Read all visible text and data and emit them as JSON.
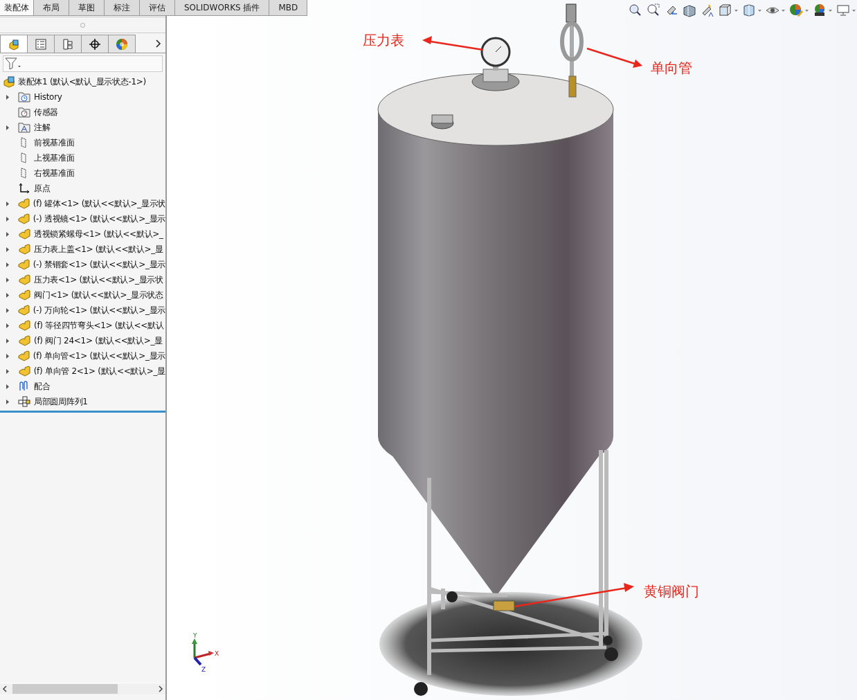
{
  "tabs": [
    {
      "label": "装配体",
      "selected": true
    },
    {
      "label": "布局",
      "selected": false
    },
    {
      "label": "草图",
      "selected": false
    },
    {
      "label": "标注",
      "selected": false
    },
    {
      "label": "评估",
      "selected": false
    },
    {
      "label": "SOLIDWORKS 插件",
      "selected": false
    },
    {
      "label": "MBD",
      "selected": false
    }
  ],
  "panel_tabs": [
    {
      "kind": "feature",
      "selected": true
    },
    {
      "kind": "property",
      "selected": false
    },
    {
      "kind": "config",
      "selected": false
    },
    {
      "kind": "dim",
      "selected": false
    },
    {
      "kind": "display",
      "selected": false
    }
  ],
  "tree": {
    "root": {
      "kind": "assembly",
      "label": "装配体1 (默认<默认_显示状态-1>)"
    },
    "items": [
      {
        "kind": "history",
        "label": "History",
        "expander": true
      },
      {
        "kind": "sensor",
        "label": "传感器",
        "expander": false
      },
      {
        "kind": "annotation",
        "label": "注解",
        "expander": true
      },
      {
        "kind": "plane",
        "label": "前视基准面",
        "expander": false
      },
      {
        "kind": "plane",
        "label": "上视基准面",
        "expander": false
      },
      {
        "kind": "plane",
        "label": "右视基准面",
        "expander": false
      },
      {
        "kind": "origin",
        "label": "原点",
        "expander": false
      },
      {
        "kind": "part",
        "label": "(f) 罐体<1> (默认<<默认>_显示状",
        "expander": true
      },
      {
        "kind": "part",
        "label": "(-) 透视镜<1> (默认<<默认>_显示",
        "expander": true
      },
      {
        "kind": "part",
        "label": "透视锁紧螺母<1> (默认<<默认>_",
        "expander": true
      },
      {
        "kind": "part",
        "label": "压力表上盖<1> (默认<<默认>_显",
        "expander": true
      },
      {
        "kind": "part",
        "label": "(-) 禁锢套<1> (默认<<默认>_显示",
        "expander": true
      },
      {
        "kind": "part",
        "label": "压力表<1> (默认<<默认>_显示状",
        "expander": true
      },
      {
        "kind": "part",
        "label": "阀门<1> (默认<<默认>_显示状态",
        "expander": true
      },
      {
        "kind": "part",
        "label": "(-) 万向轮<1> (默认<<默认>_显示",
        "expander": true
      },
      {
        "kind": "part",
        "label": "(f) 等径四节弯头<1> (默认<<默认",
        "expander": true
      },
      {
        "kind": "part",
        "label": "(f) 阀门 24<1> (默认<<默认>_显",
        "expander": true
      },
      {
        "kind": "part",
        "label": "(f) 单向管<1> (默认<<默认>_显示",
        "expander": true
      },
      {
        "kind": "part",
        "label": "(f) 单向管 2<1> (默认<<默认>_显",
        "expander": true
      },
      {
        "kind": "mates",
        "label": "配合",
        "expander": true
      },
      {
        "kind": "pattern",
        "label": "局部圆周阵列1",
        "expander": true
      }
    ]
  },
  "triad": {
    "y": "Y",
    "x": "X",
    "z": "Z"
  },
  "callouts": [
    {
      "label": "压力表"
    },
    {
      "label": "单向管"
    },
    {
      "label": "黄铜阀门"
    }
  ]
}
